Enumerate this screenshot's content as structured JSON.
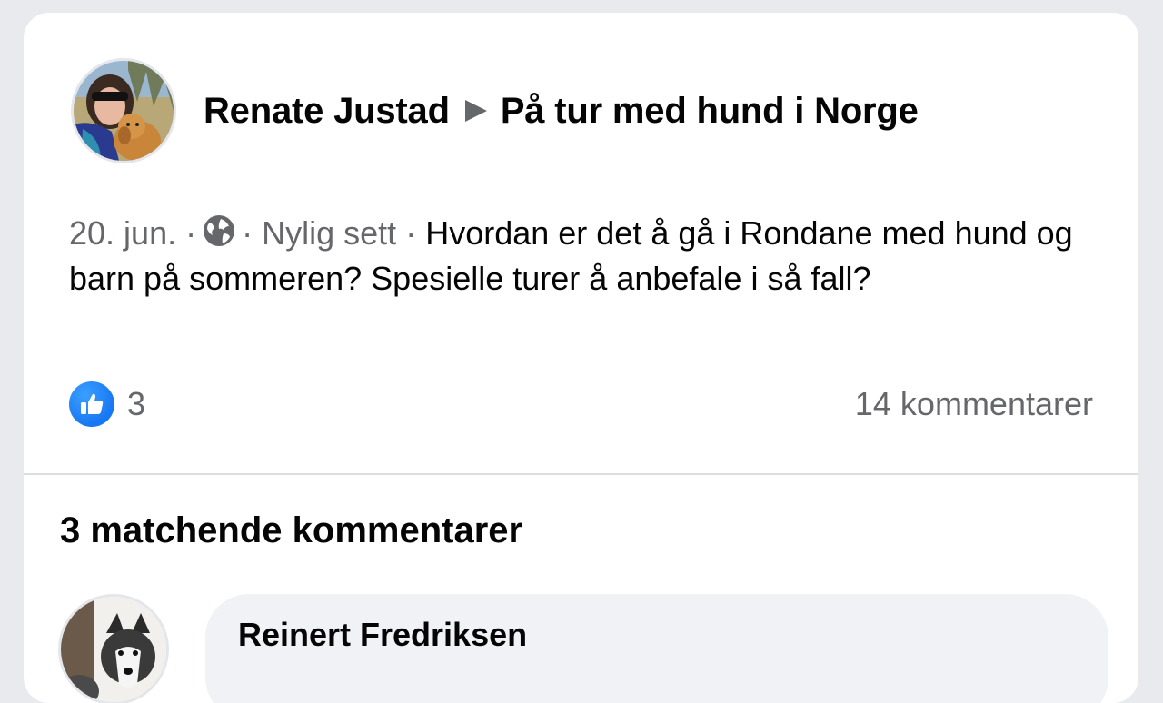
{
  "post": {
    "author": "Renate Justad",
    "group": "På tur med hund i Norge",
    "date": "20. jun.",
    "separator": "·",
    "seen_status": "Nylig sett",
    "text": "Hvordan er det å gå i Rondane med hund og barn på sommeren? Spesielle turer å anbefale i så fall?",
    "like_count": "3",
    "comment_count": "14 kommentarer",
    "icons": {
      "privacy": "globe-icon",
      "reaction": "like-icon",
      "arrow": "triangle-right-icon"
    },
    "colors": {
      "like_blue": "#1877f2",
      "meta_gray": "#65676b"
    }
  },
  "matches": {
    "heading": "3 matchende kommentarer",
    "comments": [
      {
        "author": "Reinert Fredriksen"
      }
    ]
  }
}
